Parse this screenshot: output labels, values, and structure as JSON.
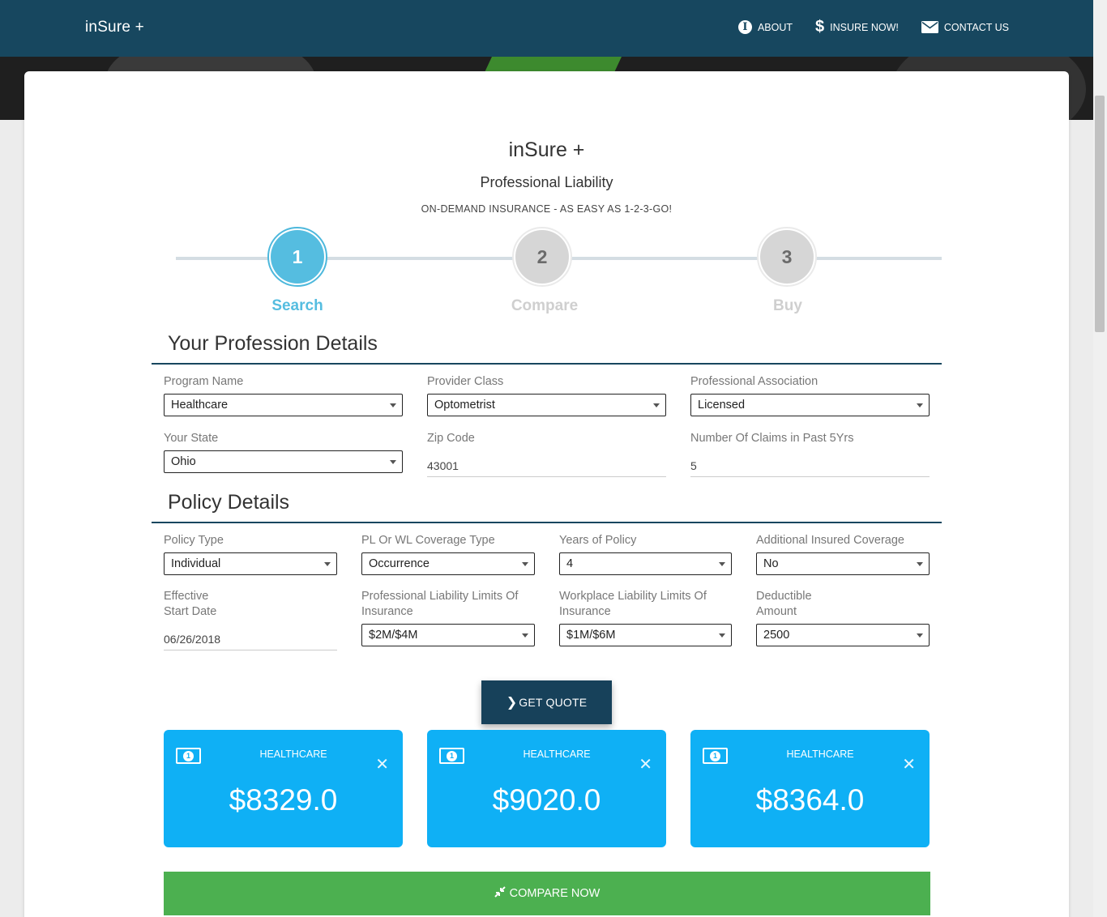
{
  "nav": {
    "brand": "inSure +",
    "links": [
      {
        "label": "ABOUT",
        "icon": "info-icon"
      },
      {
        "label": "INSURE NOW!",
        "icon": "dollar-icon"
      },
      {
        "label": "CONTACT US",
        "icon": "envelope-icon"
      }
    ]
  },
  "header": {
    "title": "inSure +",
    "subtitle": "Professional Liability",
    "tagline": "ON-DEMAND INSURANCE - AS EASY AS 1-2-3-GO!"
  },
  "steps": [
    {
      "number": "1",
      "label": "Search",
      "active": true
    },
    {
      "number": "2",
      "label": "Compare",
      "active": false
    },
    {
      "number": "3",
      "label": "Buy",
      "active": false
    }
  ],
  "profession": {
    "title": "Your Profession Details",
    "program_name": {
      "label": "Program Name",
      "value": "Healthcare"
    },
    "provider_class": {
      "label": "Provider Class",
      "value": "Optometrist"
    },
    "professional_association": {
      "label": "Professional Association",
      "value": "Licensed"
    },
    "state": {
      "label": "Your State",
      "value": "Ohio"
    },
    "zip": {
      "label": "Zip Code",
      "value": "43001"
    },
    "claims": {
      "label": "Number Of Claims in Past 5Yrs",
      "value": "5"
    }
  },
  "policy": {
    "title": "Policy Details",
    "policy_type": {
      "label": "Policy Type",
      "value": "Individual"
    },
    "coverage_type": {
      "label": "PL Or WL Coverage Type",
      "value": "Occurrence"
    },
    "years": {
      "label": "Years of Policy",
      "value": "4"
    },
    "additional_insured": {
      "label": "Additional Insured Coverage",
      "value": "No"
    },
    "effective_date": {
      "label_line1": "Effective",
      "label_line2": "Start Date",
      "value": "06/26/2018"
    },
    "pl_limits": {
      "label_line1": "Professional Liability Limits Of",
      "label_line2": "Insurance",
      "value": "$2M/$4M"
    },
    "wl_limits": {
      "label_line1": "Workplace Liability Limits Of",
      "label_line2": "Insurance",
      "value": "$1M/$6M"
    },
    "deductible": {
      "label_line1": "Deductible",
      "label_line2": "Amount",
      "value": "2500"
    }
  },
  "actions": {
    "get_quote": "GET QUOTE",
    "compare_now": "COMPARE NOW"
  },
  "quotes": [
    {
      "label": "HEALTHCARE",
      "amount": "$8329.0"
    },
    {
      "label": "HEALTHCARE",
      "amount": "$9020.0"
    },
    {
      "label": "HEALTHCARE",
      "amount": "$8364.0"
    }
  ],
  "colors": {
    "navbar": "#17475f",
    "step_active": "#55bde0",
    "quote_card": "#0fb0f5",
    "compare_button": "#4cb050",
    "get_quote_button": "#17415a"
  }
}
